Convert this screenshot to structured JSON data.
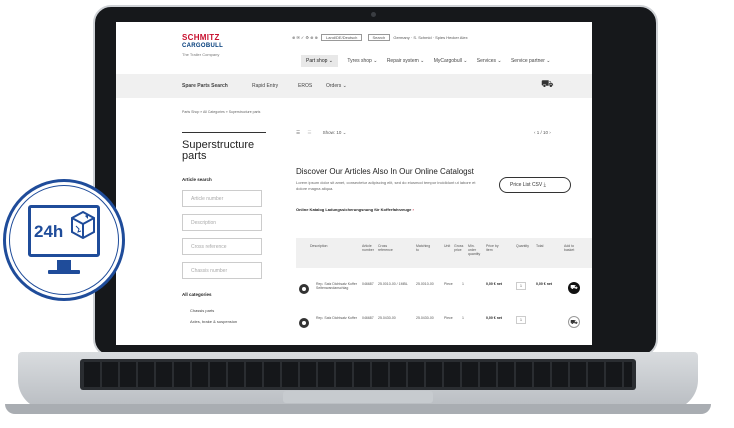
{
  "brand": {
    "logo_line1": "SCHMITZ",
    "logo_line2": "CARGOBULL",
    "tagline": "The Trailer Company"
  },
  "utility": {
    "icons": "⊕ ✉ ✓ ⚙ ⊕ ⊕",
    "dropdown": "Land/DE/Deutsch",
    "search": "Search",
    "account": "Germany · S. Schmid · Spies Hecker Alex"
  },
  "mainnav": [
    "Part shop ⌄",
    "Tyres shop ⌄",
    "Repair system ⌄",
    "MyCargobull ⌄",
    "Services ⌄",
    "Service partner ⌄"
  ],
  "subnav": {
    "items": [
      "Spare Parts Search",
      "Rapid Entry",
      "EROS",
      "Orders ⌄"
    ],
    "cart_icon": "cart-icon"
  },
  "breadcrumb": "Parts Shop  »  All Categories  »  Superstructure parts",
  "sidebar": {
    "title": "Superstructure parts",
    "article_search_label": "Article search",
    "fields": [
      "Article number",
      "Description",
      "Cross reference",
      "Chassis number"
    ],
    "categories_label": "All categories",
    "categories": [
      "Chassis parts",
      "Axles, brake & suspension"
    ]
  },
  "toolbar": {
    "show": "Show: 10  ⌄",
    "pager": "‹   1 / 10   ›"
  },
  "promo": {
    "heading": "Discover Our Articles Also In Our Online Catalogst",
    "body": "Lorem ipsum dolor sit amet, consectetur adipiscing elit, sed do eiusmod tempor incididunt ut labore et dolore magna aliqua.",
    "link": "Online Katalog Ladungssicherungsnung für Kofferfahrzeuge",
    "link_arrow": "›",
    "price_button": "Price List CSV  ⤓"
  },
  "table": {
    "headers": [
      "Description",
      "Article number",
      "Cross reference",
      "Matching to",
      "Unit",
      "Gross price",
      "Min. order quantity",
      "Price by item",
      "Quantity",
      "Total",
      "Add to basket"
    ],
    "rows": [
      {
        "description": "Rep. Satz Dichtsatz Koffer Seitenwandanschlag",
        "article": "046687",
        "cross": "25.0010-00 / 1MBL",
        "matching": "25.0010-00",
        "unit": "Piece",
        "qty": "1",
        "price": "0,00 € net",
        "quantity": "1",
        "total": "0,00 € net"
      },
      {
        "description": "Rep. Satz Dichtsatz Koffer",
        "article": "046687",
        "cross": "25.0430-00",
        "matching": "25.0430-00",
        "unit": "Piece",
        "qty": "1",
        "price": "0,00 € net",
        "quantity": "1",
        "total": "0,00 € net"
      }
    ]
  },
  "badge": {
    "label": "24h"
  },
  "colors": {
    "brand_red": "#c8102e",
    "brand_blue": "#003b7a",
    "badge_blue": "#1f4c9a"
  }
}
